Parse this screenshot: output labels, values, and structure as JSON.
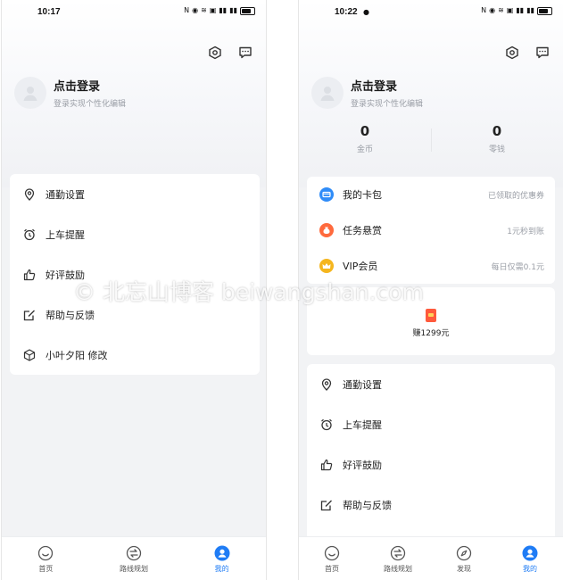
{
  "left": {
    "status": {
      "time": "10:17"
    },
    "profile": {
      "title": "点击登录",
      "subtitle": "登录实现个性化编辑"
    },
    "menu": [
      {
        "label": "通勤设置",
        "icon": "location-pin-icon"
      },
      {
        "label": "上车提醒",
        "icon": "alarm-clock-icon"
      },
      {
        "label": "好评鼓励",
        "icon": "thumbs-up-icon"
      },
      {
        "label": "帮助与反馈",
        "icon": "edit-icon"
      },
      {
        "label": "小叶夕阳 修改",
        "icon": "hexagon-icon"
      }
    ],
    "tabs": [
      {
        "label": "首页",
        "icon": "smile-icon"
      },
      {
        "label": "路线规划",
        "icon": "route-icon"
      },
      {
        "label": "我的",
        "icon": "user-icon",
        "active": true
      }
    ]
  },
  "right": {
    "status": {
      "time": "10:22"
    },
    "profile": {
      "title": "点击登录",
      "subtitle": "登录实现个性化编辑"
    },
    "stats": [
      {
        "value": "0",
        "label": "金币"
      },
      {
        "value": "0",
        "label": "零钱"
      }
    ],
    "services": [
      {
        "label": "我的卡包",
        "right": "已领取的优惠券",
        "icon": "card-icon",
        "color": "#2f8cf8"
      },
      {
        "label": "任务悬赏",
        "right": "1元秒到账",
        "icon": "money-bag-icon",
        "color": "#ff6a3d"
      },
      {
        "label": "VIP会员",
        "right": "每日仅需0.1元",
        "icon": "crown-icon",
        "color": "#f5b61e"
      }
    ],
    "promo": {
      "text": "赚1299元"
    },
    "menu": [
      {
        "label": "通勤设置",
        "icon": "location-pin-icon"
      },
      {
        "label": "上车提醒",
        "icon": "alarm-clock-icon"
      },
      {
        "label": "好评鼓励",
        "icon": "thumbs-up-icon"
      },
      {
        "label": "帮助与反馈",
        "icon": "edit-icon"
      }
    ],
    "tabs": [
      {
        "label": "首页",
        "icon": "smile-icon"
      },
      {
        "label": "路线规划",
        "icon": "route-icon"
      },
      {
        "label": "发现",
        "icon": "compass-icon"
      },
      {
        "label": "我的",
        "icon": "user-icon",
        "active": true
      }
    ]
  },
  "watermark": "© 北忘山博客 beiwangshan.com",
  "colors": {
    "accent": "#1f7cf5",
    "background": "#f2f3f5"
  }
}
